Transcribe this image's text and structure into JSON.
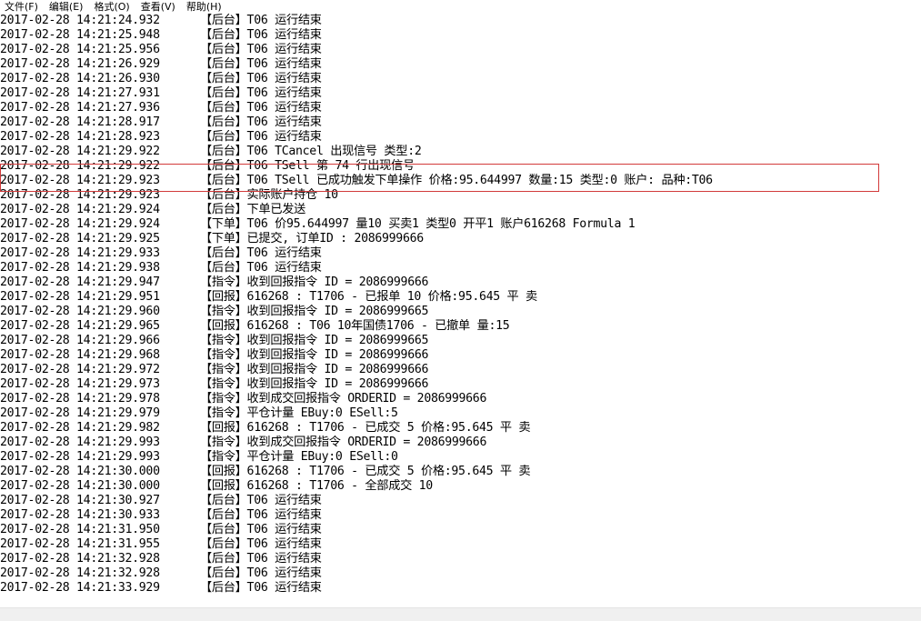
{
  "menu": [
    {
      "label": "文件(F)"
    },
    {
      "label": "编辑(E)"
    },
    {
      "label": "格式(O)"
    },
    {
      "label": "查看(V)"
    },
    {
      "label": "帮助(H)"
    }
  ],
  "lines": [
    {
      "ts": "2017-02-28 14:21:24.932",
      "msg": "【后台】T06 运行结束"
    },
    {
      "ts": "2017-02-28 14:21:25.948",
      "msg": "【后台】T06 运行结束"
    },
    {
      "ts": "2017-02-28 14:21:25.956",
      "msg": "【后台】T06 运行结束"
    },
    {
      "ts": "2017-02-28 14:21:26.929",
      "msg": "【后台】T06 运行结束"
    },
    {
      "ts": "2017-02-28 14:21:26.930",
      "msg": "【后台】T06 运行结束"
    },
    {
      "ts": "2017-02-28 14:21:27.931",
      "msg": "【后台】T06 运行结束"
    },
    {
      "ts": "2017-02-28 14:21:27.936",
      "msg": "【后台】T06 运行结束"
    },
    {
      "ts": "2017-02-28 14:21:28.917",
      "msg": "【后台】T06 运行结束"
    },
    {
      "ts": "2017-02-28 14:21:28.923",
      "msg": "【后台】T06 运行结束"
    },
    {
      "ts": "2017-02-28 14:21:29.922",
      "msg": "【后台】T06 TCancel 出现信号 类型:2"
    },
    {
      "ts": "2017-02-28 14:21:29.922",
      "msg": "【后台】T06 TSell 第 74 行出现信号"
    },
    {
      "ts": "2017-02-28 14:21:29.923",
      "msg": "【后台】T06 TSell 已成功触发下单操作 价格:95.644997 数量:15 类型:0 账户: 品种:T06"
    },
    {
      "ts": "2017-02-28 14:21:29.923",
      "msg": "【后台】实际账户持仓 10"
    },
    {
      "ts": "2017-02-28 14:21:29.924",
      "msg": "【后台】下单已发送"
    },
    {
      "ts": "2017-02-28 14:21:29.924",
      "msg": "【下单】T06 价95.644997 量10 买卖1 类型0 开平1 账户616268 Formula 1"
    },
    {
      "ts": "2017-02-28 14:21:29.925",
      "msg": "【下单】已提交, 订单ID : 2086999666"
    },
    {
      "ts": "2017-02-28 14:21:29.933",
      "msg": "【后台】T06 运行结束"
    },
    {
      "ts": "2017-02-28 14:21:29.938",
      "msg": "【后台】T06 运行结束"
    },
    {
      "ts": "2017-02-28 14:21:29.947",
      "msg": "【指令】收到回报指令 ID = 2086999666"
    },
    {
      "ts": "2017-02-28 14:21:29.951",
      "msg": "【回报】616268 : T1706 - 已报单 10 价格:95.645 平 卖"
    },
    {
      "ts": "2017-02-28 14:21:29.960",
      "msg": "【指令】收到回报指令 ID = 2086999665"
    },
    {
      "ts": "2017-02-28 14:21:29.965",
      "msg": "【回报】616268 : T06 10年国债1706 - 已撤单 量:15"
    },
    {
      "ts": "2017-02-28 14:21:29.966",
      "msg": "【指令】收到回报指令 ID = 2086999665"
    },
    {
      "ts": "2017-02-28 14:21:29.968",
      "msg": "【指令】收到回报指令 ID = 2086999666"
    },
    {
      "ts": "2017-02-28 14:21:29.972",
      "msg": "【指令】收到回报指令 ID = 2086999666"
    },
    {
      "ts": "2017-02-28 14:21:29.973",
      "msg": "【指令】收到回报指令 ID = 2086999666"
    },
    {
      "ts": "2017-02-28 14:21:29.978",
      "msg": "【指令】收到成交回报指令 ORDERID = 2086999666"
    },
    {
      "ts": "2017-02-28 14:21:29.979",
      "msg": "【指令】平仓计量 EBuy:0 ESell:5"
    },
    {
      "ts": "2017-02-28 14:21:29.982",
      "msg": "【回报】616268 : T1706 - 已成交 5 价格:95.645 平 卖"
    },
    {
      "ts": "2017-02-28 14:21:29.993",
      "msg": "【指令】收到成交回报指令 ORDERID = 2086999666"
    },
    {
      "ts": "2017-02-28 14:21:29.993",
      "msg": "【指令】平仓计量 EBuy:0 ESell:0"
    },
    {
      "ts": "2017-02-28 14:21:30.000",
      "msg": "【回报】616268 : T1706 - 已成交 5 价格:95.645 平 卖"
    },
    {
      "ts": "2017-02-28 14:21:30.000",
      "msg": "【回报】616268 : T1706 - 全部成交 10"
    },
    {
      "ts": "2017-02-28 14:21:30.927",
      "msg": "【后台】T06 运行结束"
    },
    {
      "ts": "2017-02-28 14:21:30.933",
      "msg": "【后台】T06 运行结束"
    },
    {
      "ts": "2017-02-28 14:21:31.950",
      "msg": "【后台】T06 运行结束"
    },
    {
      "ts": "2017-02-28 14:21:31.955",
      "msg": "【后台】T06 运行结束"
    },
    {
      "ts": "2017-02-28 14:21:32.928",
      "msg": "【后台】T06 运行结束"
    },
    {
      "ts": "2017-02-28 14:21:32.928",
      "msg": "【后台】T06 运行结束"
    },
    {
      "ts": "2017-02-28 14:21:33.929",
      "msg": "【后台】T06 运行结束"
    }
  ],
  "highlight": {
    "from_line": 10,
    "to_line": 11,
    "color": "#d23a3a"
  }
}
